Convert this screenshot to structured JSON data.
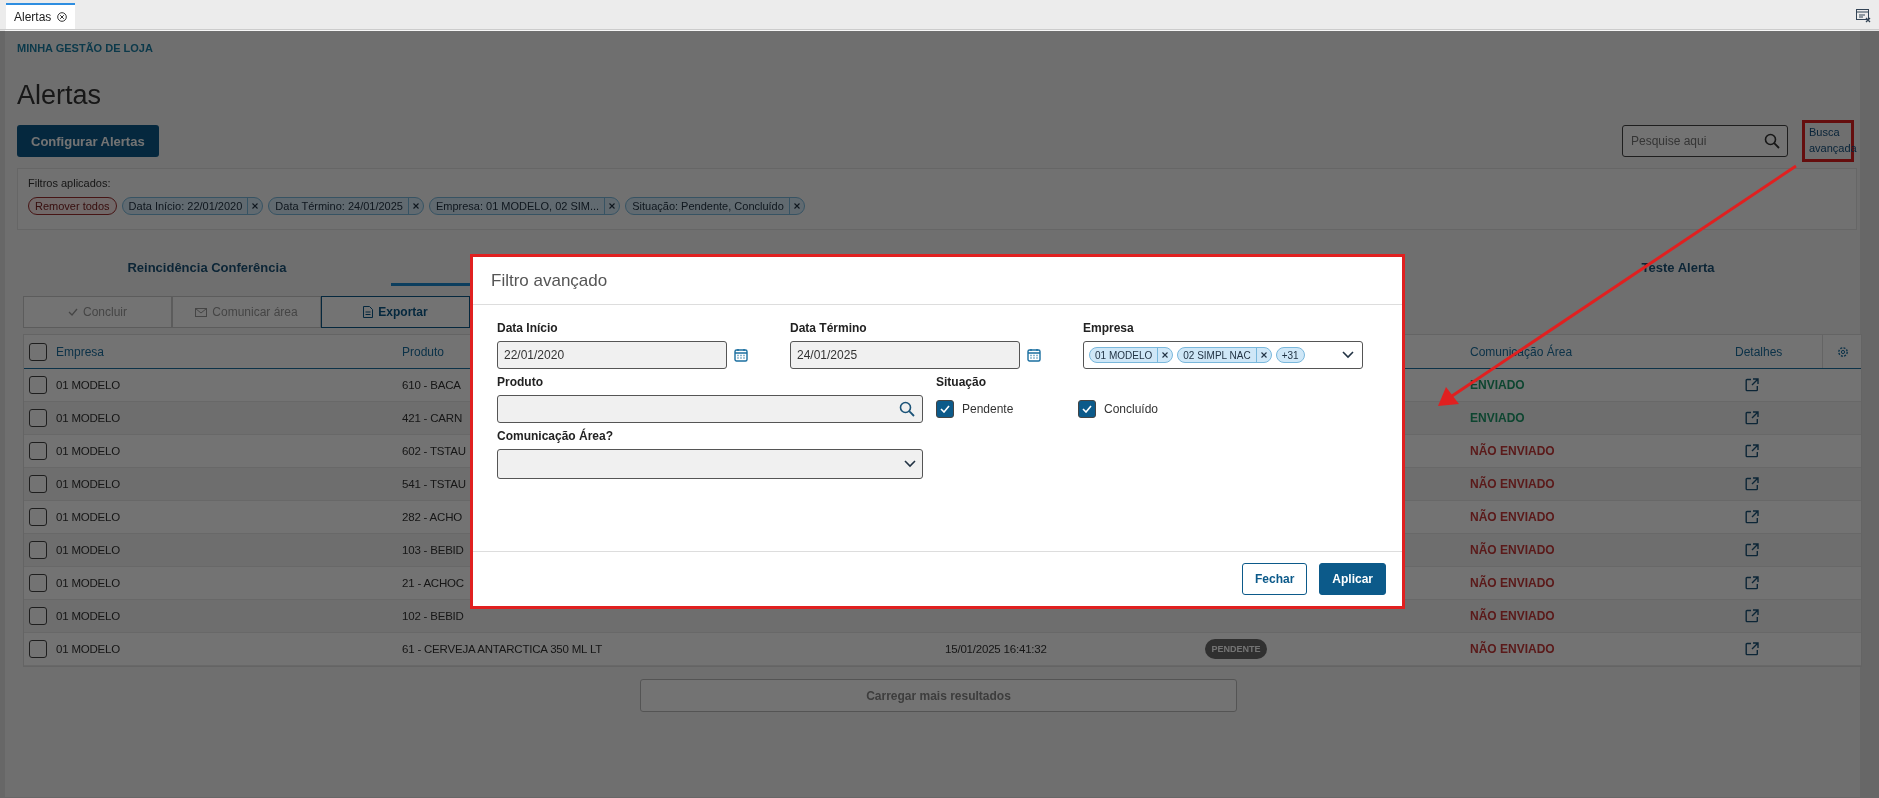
{
  "tab_bar": {
    "tabs": [
      {
        "label": "Alertas",
        "selected": true
      }
    ]
  },
  "breadcrumb": "MINHA GESTÃO DE LOJA",
  "title": "Alertas",
  "configure_button": "Configurar Alertas",
  "search": {
    "placeholder": "Pesquise aqui"
  },
  "advanced_search_link": "Busca avançada",
  "filters": {
    "label": "Filtros aplicados:",
    "remove_all": "Remover todos",
    "chips": [
      {
        "label": "Data Início: 22/01/2020"
      },
      {
        "label": "Data Término: 24/01/2025"
      },
      {
        "label": "Empresa: 01 MODELO, 02 SIM..."
      },
      {
        "label": "Situação: Pendente, Concluído"
      }
    ]
  },
  "view_tabs": [
    {
      "label": "Reincidência Conferência",
      "selected": false
    },
    {
      "selected": true
    },
    {
      "label": "Teste Alerta",
      "selected": false
    }
  ],
  "actions": [
    {
      "label": "Concluir",
      "disabled": true
    },
    {
      "label": "Comunicar área",
      "disabled": true
    },
    {
      "label": "Exportar",
      "disabled": false
    }
  ],
  "table": {
    "headers": {
      "empresa": "Empresa",
      "produto": "Produto",
      "comunicacao": "Comunicação Área",
      "detalhes": "Detalhes"
    },
    "select_all_checked": false,
    "rows": [
      {
        "checked": false,
        "empresa": "01 MODELO",
        "produto": "610 - BACA",
        "comunicacao": "ENVIADO",
        "sent": true
      },
      {
        "checked": false,
        "empresa": "01 MODELO",
        "produto": "421 - CARN",
        "comunicacao": "ENVIADO",
        "sent": true
      },
      {
        "checked": false,
        "empresa": "01 MODELO",
        "produto": "602 - TSTAU",
        "comunicacao": "NÃO ENVIADO",
        "sent": false
      },
      {
        "checked": false,
        "empresa": "01 MODELO",
        "produto": "541 - TSTAU",
        "comunicacao": "NÃO ENVIADO",
        "sent": false
      },
      {
        "checked": false,
        "empresa": "01 MODELO",
        "produto": "282 - ACHO",
        "comunicacao": "NÃO ENVIADO",
        "sent": false
      },
      {
        "checked": false,
        "empresa": "01 MODELO",
        "produto": "103 - BEBID",
        "comunicacao": "NÃO ENVIADO",
        "sent": false
      },
      {
        "checked": false,
        "empresa": "01 MODELO",
        "produto": "21 - ACHOC",
        "comunicacao": "NÃO ENVIADO",
        "sent": false
      },
      {
        "checked": false,
        "empresa": "01 MODELO",
        "produto": "102 - BEBID",
        "comunicacao": "NÃO ENVIADO",
        "sent": false
      },
      {
        "checked": false,
        "empresa": "01 MODELO",
        "produto": "61 - CERVEJA ANTARCTICA 350 ML LT",
        "date": "15/01/2025 16:41:32",
        "status": "PENDENTE",
        "comunicacao": "NÃO ENVIADO",
        "sent": false
      }
    ]
  },
  "load_more": "Carregar mais resultados",
  "dialog": {
    "title": "Filtro avançado",
    "data_inicio": {
      "label": "Data Início",
      "value": "22/01/2020"
    },
    "data_termino": {
      "label": "Data Término",
      "value": "24/01/2025"
    },
    "empresa": {
      "label": "Empresa",
      "chips": [
        {
          "label": "01 MODELO"
        },
        {
          "label": "02 SIMPL NAC"
        }
      ],
      "more": "+31"
    },
    "produto": {
      "label": "Produto"
    },
    "situacao": {
      "label": "Situação",
      "options": [
        {
          "label": "Pendente",
          "checked": true
        },
        {
          "label": "Concluído",
          "checked": true
        }
      ]
    },
    "comunicacao": {
      "label": "Comunicação Área?"
    },
    "buttons": {
      "close": "Fechar",
      "apply": "Aplicar"
    }
  }
}
